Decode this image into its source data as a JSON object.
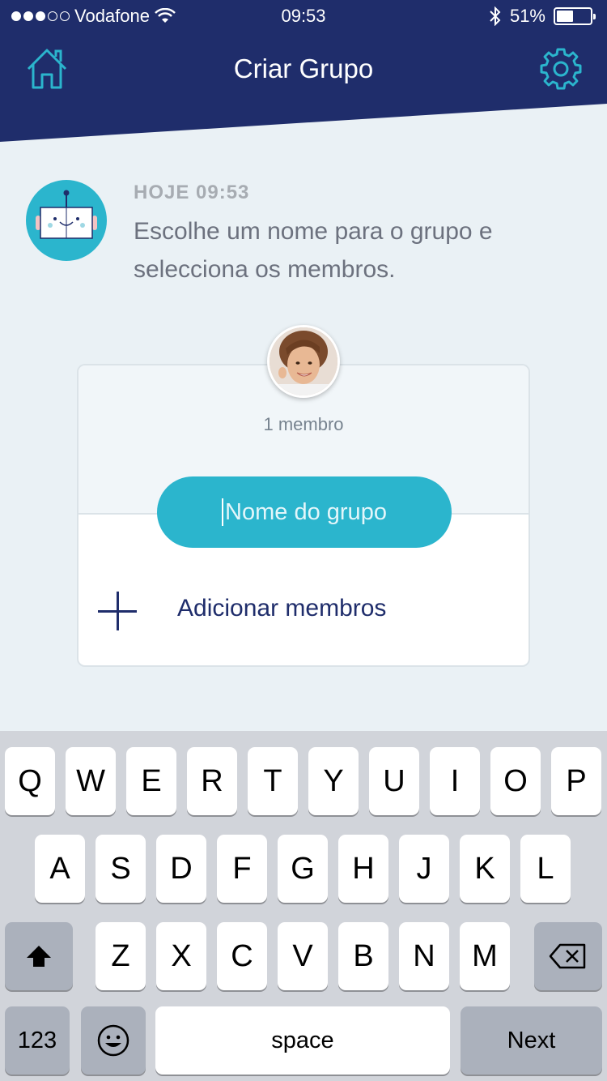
{
  "status_bar": {
    "carrier": "Vodafone",
    "time": "09:53",
    "battery": "51%",
    "battery_level": 0.51
  },
  "header": {
    "title": "Criar Grupo",
    "home_icon": "home-icon",
    "settings_icon": "gear-icon",
    "background_color": "#1f2d6b"
  },
  "message": {
    "timestamp": "HOJE 09:53",
    "text": "Escolhe um nome para o grupo e selecciona os membros."
  },
  "group_card": {
    "member_count": "1 membro",
    "name_placeholder": "Nome do grupo",
    "add_members_label": "Adicionar membros",
    "accent_color": "#2bb5cd"
  },
  "keyboard": {
    "row1": [
      "Q",
      "W",
      "E",
      "R",
      "T",
      "Y",
      "U",
      "I",
      "O",
      "P"
    ],
    "row2": [
      "A",
      "S",
      "D",
      "F",
      "G",
      "H",
      "J",
      "K",
      "L"
    ],
    "row3": [
      "Z",
      "X",
      "C",
      "V",
      "B",
      "N",
      "M"
    ],
    "numbers_label": "123",
    "space_label": "space",
    "next_label": "Next"
  }
}
